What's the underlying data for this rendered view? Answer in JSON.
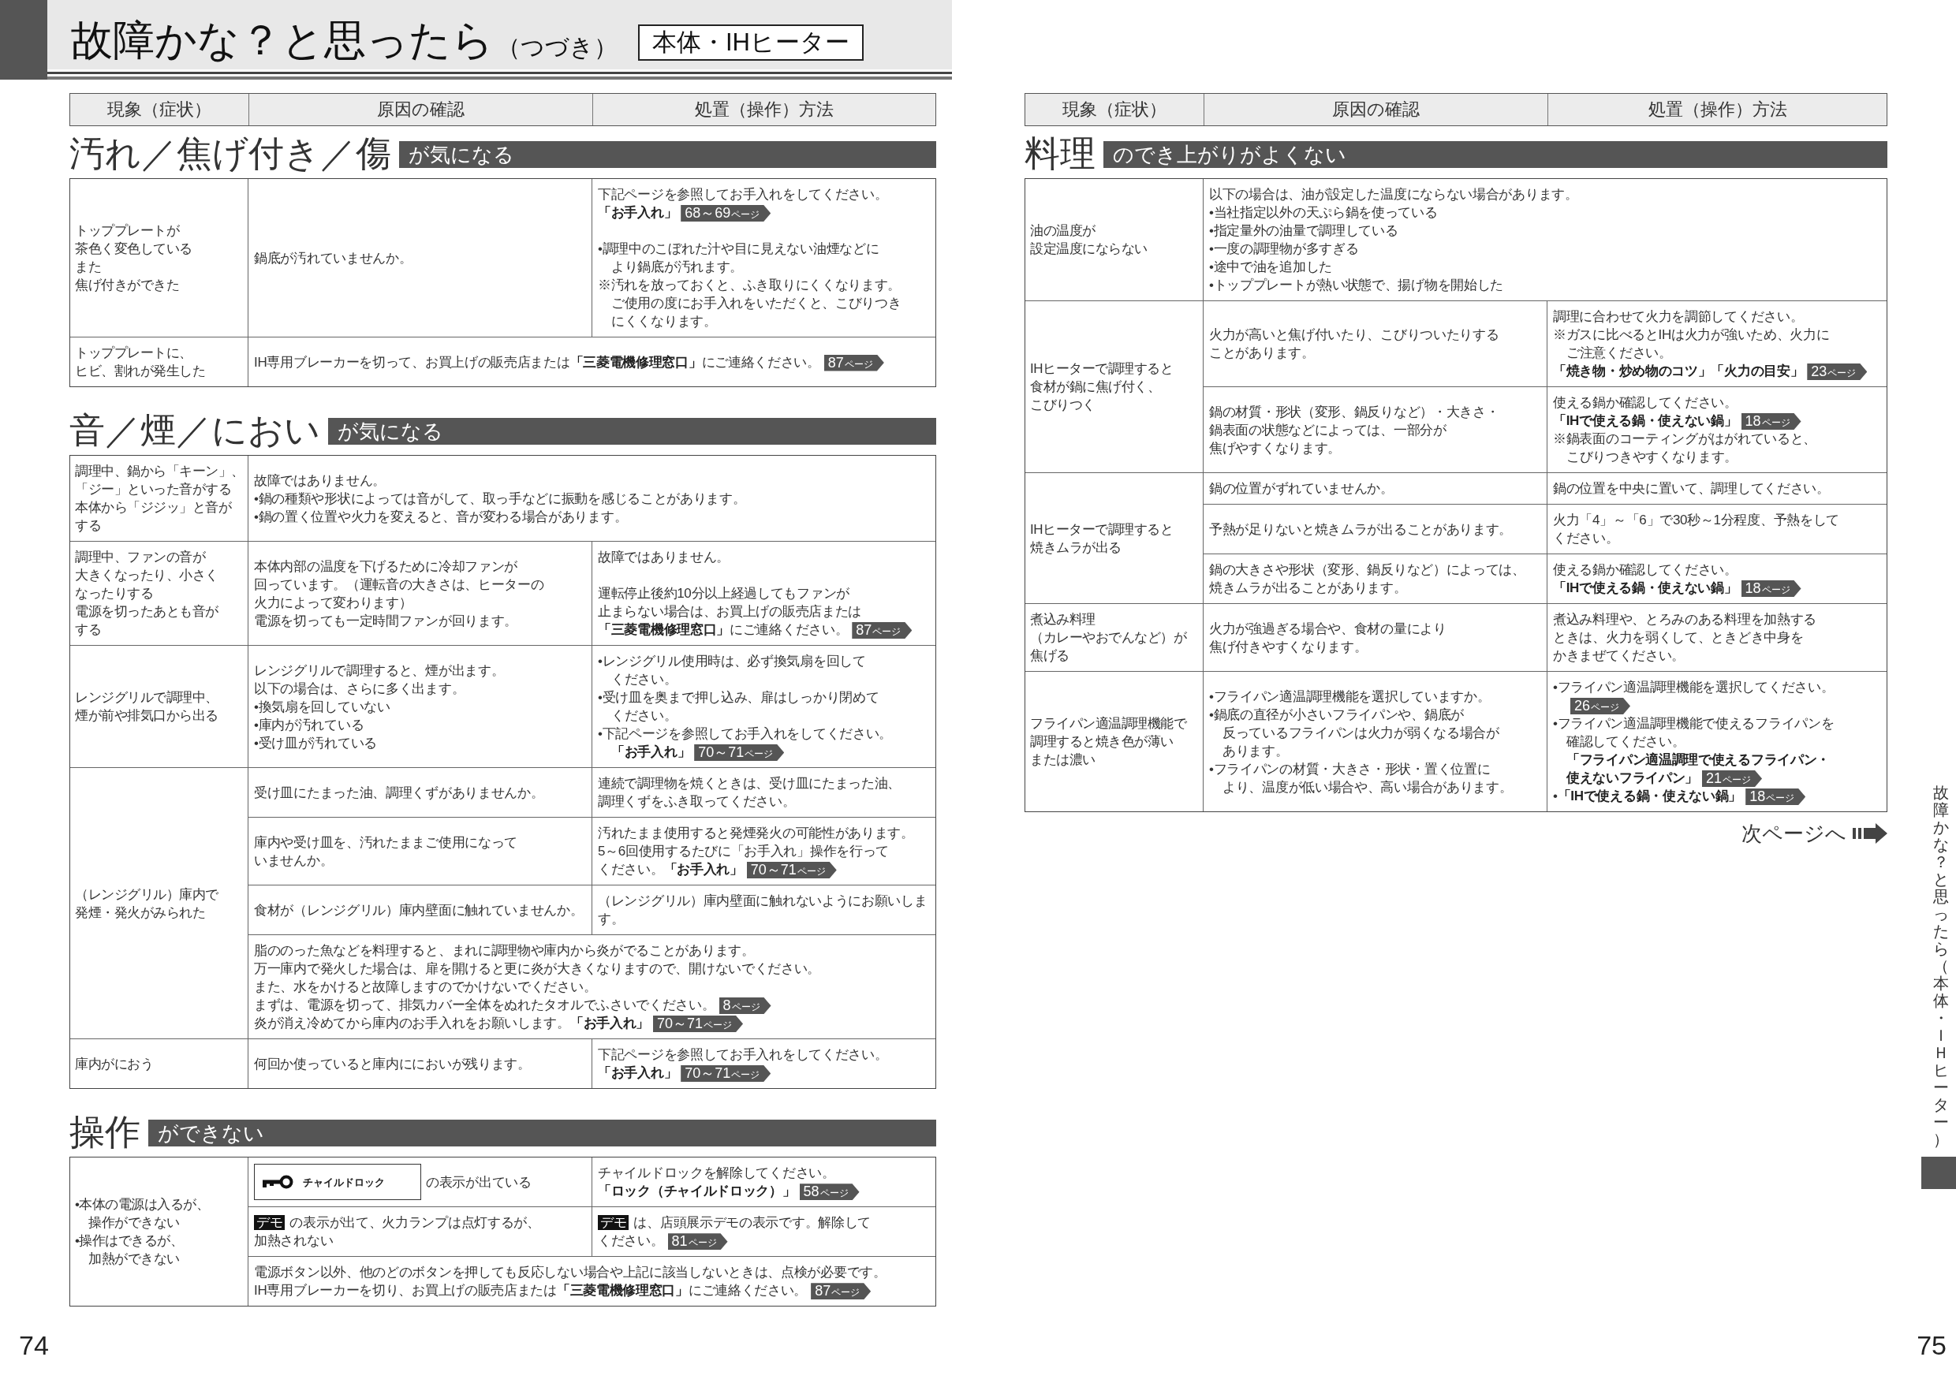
{
  "header": {
    "title": "故障かな？と思ったら",
    "suffix": "（つづき）",
    "category": "本体・IHヒーター"
  },
  "pages": [
    {
      "number": "74",
      "columns": [
        "現象（症状）",
        "原因の確認",
        "処置（操作）方法"
      ],
      "sections": [
        {
          "heading": "汚れ／焦げ付き／傷",
          "banner": "が気になる",
          "rows": [
            {
              "symptom": [
                {
                  "kind": "text",
                  "lines": [
                    "トッププレートが",
                    "茶色く変色している",
                    "また",
                    "焦げ付きができた"
                  ]
                }
              ],
              "entries": [
                {
                  "kind": "split",
                  "cause": [
                    {
                      "kind": "text",
                      "lines": [
                        "鍋底が汚れていませんか。"
                      ]
                    }
                  ],
                  "remedy": [
                    {
                      "kind": "text",
                      "lines": [
                        "下記ページを参照してお手入れをしてください。",
                        "**「お手入れ」**"
                      ],
                      "ref": {
                        "page": "68～69",
                        "unit": "ページ"
                      }
                    },
                    {
                      "kind": "bullet",
                      "spaced": true,
                      "lines": [
                        "•調理中のこぼれた汁や目に見えない油煙などに",
                        "より鍋底が汚れます。"
                      ]
                    },
                    {
                      "kind": "note",
                      "lines": [
                        "※汚れを放っておくと、ふき取りにくくなります。",
                        "ご使用の度にお手入れをいただくと、こびりつき",
                        "にくくなります。"
                      ]
                    }
                  ]
                }
              ]
            },
            {
              "symptom": [
                {
                  "kind": "text",
                  "lines": [
                    "トッププレートに、",
                    "ヒビ、割れが発生した"
                  ]
                }
              ],
              "entries": [
                {
                  "kind": "merged",
                  "content": [
                    {
                      "kind": "text",
                      "lines": [
                        "IH専用ブレーカーを切って、お買上げの販売店または**「三菱電機修理窓口」**にご連絡ください。"
                      ],
                      "ref": {
                        "page": "87",
                        "unit": "ページ"
                      }
                    }
                  ]
                }
              ]
            }
          ]
        },
        {
          "heading": "音／煙／におい",
          "banner": "が気になる",
          "rows": [
            {
              "symptom": [
                {
                  "kind": "text",
                  "lines": [
                    "調理中、鍋から「キーン」、",
                    "「ジー」といった音がする",
                    "本体から「ジジッ」と音が",
                    "する"
                  ]
                }
              ],
              "entries": [
                {
                  "kind": "merged",
                  "content": [
                    {
                      "kind": "text",
                      "lines": [
                        "故障ではありません。"
                      ]
                    },
                    {
                      "kind": "bullet",
                      "lines": [
                        "•鍋の種類や形状によっては音がして、取っ手などに振動を感じることがあります。"
                      ]
                    },
                    {
                      "kind": "bullet",
                      "lines": [
                        "•鍋の置く位置や火力を変えると、音が変わる場合があります。"
                      ]
                    }
                  ]
                }
              ]
            },
            {
              "symptom": [
                {
                  "kind": "text",
                  "lines": [
                    "調理中、ファンの音が",
                    "大きくなったり、小さく",
                    "なったりする",
                    "電源を切ったあとも音が",
                    "する"
                  ]
                }
              ],
              "entries": [
                {
                  "kind": "split",
                  "cause": [
                    {
                      "kind": "text",
                      "lines": [
                        "本体内部の温度を下げるために冷却ファンが",
                        "回っています。（運転音の大きさは、ヒーターの",
                        "火力によって変わります）",
                        "電源を切っても一定時間ファンが回ります。"
                      ]
                    }
                  ],
                  "remedy": [
                    {
                      "kind": "text",
                      "lines": [
                        "故障ではありません。"
                      ]
                    },
                    {
                      "kind": "text",
                      "spaced": true,
                      "lines": [
                        "運転停止後約10分以上経過してもファンが",
                        "止まらない場合は、お買上げの販売店または",
                        "**「三菱電機修理窓口」**にご連絡ください。"
                      ],
                      "ref": {
                        "page": "87",
                        "unit": "ページ"
                      }
                    }
                  ]
                }
              ]
            },
            {
              "symptom": [
                {
                  "kind": "text",
                  "lines": [
                    "レンジグリルで調理中、",
                    "煙が前や排気口から出る"
                  ]
                }
              ],
              "entries": [
                {
                  "kind": "split",
                  "cause": [
                    {
                      "kind": "text",
                      "lines": [
                        "レンジグリルで調理すると、煙が出ます。",
                        "以下の場合は、さらに多く出ます。"
                      ]
                    },
                    {
                      "kind": "bullet",
                      "lines": [
                        "•換気扇を回していない"
                      ]
                    },
                    {
                      "kind": "bullet",
                      "lines": [
                        "•庫内が汚れている"
                      ]
                    },
                    {
                      "kind": "bullet",
                      "lines": [
                        "•受け皿が汚れている"
                      ]
                    }
                  ],
                  "remedy": [
                    {
                      "kind": "bullet",
                      "lines": [
                        "•レンジグリル使用時は、必ず換気扇を回して",
                        "ください。"
                      ]
                    },
                    {
                      "kind": "bullet",
                      "lines": [
                        "•受け皿を奥まで押し込み、扉はしっかり閉めて",
                        "ください。"
                      ]
                    },
                    {
                      "kind": "bullet",
                      "lines": [
                        "•下記ページを参照してお手入れをしてください。",
                        "**「お手入れ」**"
                      ],
                      "ref": {
                        "page": "70～71",
                        "unit": "ページ"
                      }
                    }
                  ]
                }
              ]
            },
            {
              "symptom": [
                {
                  "kind": "text",
                  "lines": [
                    "（レンジグリル）庫内で",
                    "発煙・発火がみられた"
                  ]
                }
              ],
              "entries": [
                {
                  "kind": "split",
                  "cause": [
                    {
                      "kind": "text",
                      "lines": [
                        "受け皿にたまった油、調理くずがありませんか。"
                      ]
                    }
                  ],
                  "remedy": [
                    {
                      "kind": "text",
                      "lines": [
                        "連続で調理物を焼くときは、受け皿にたまった油、",
                        "調理くずをふき取ってください。"
                      ]
                    }
                  ]
                },
                {
                  "kind": "split",
                  "cause": [
                    {
                      "kind": "text",
                      "lines": [
                        "庫内や受け皿を、汚れたままご使用になって",
                        "いませんか。"
                      ]
                    }
                  ],
                  "remedy": [
                    {
                      "kind": "text",
                      "lines": [
                        "汚れたまま使用すると発煙発火の可能性があります。",
                        "5～6回使用するたびに「お手入れ」操作を行って",
                        "ください。**「お手入れ」**"
                      ],
                      "ref": {
                        "page": "70～71",
                        "unit": "ページ"
                      }
                    }
                  ]
                },
                {
                  "kind": "split",
                  "cause": [
                    {
                      "kind": "text",
                      "lines": [
                        "食材が（レンジグリル）庫内壁面に触れていませんか。"
                      ]
                    }
                  ],
                  "remedy": [
                    {
                      "kind": "text",
                      "lines": [
                        "（レンジグリル）庫内壁面に触れないようにお願いします。"
                      ]
                    }
                  ]
                },
                {
                  "kind": "merged",
                  "content": [
                    {
                      "kind": "text",
                      "lines": [
                        "脂ののった魚などを料理すると、まれに調理物や庫内から炎がでることがあります。",
                        "万一庫内で発火した場合は、扉を開けると更に炎が大きくなりますので、開けないでください。",
                        "また、水をかけると故障しますのでかけないでください。",
                        "まずは、電源を切って、排気カバー全体をぬれたタオルでふさいでください。"
                      ],
                      "ref": {
                        "page": "8",
                        "unit": "ページ"
                      }
                    },
                    {
                      "kind": "text",
                      "lines": [
                        "炎が消え冷めてから庫内のお手入れをお願いします。**「お手入れ」**"
                      ],
                      "ref": {
                        "page": "70～71",
                        "unit": "ページ"
                      }
                    }
                  ]
                }
              ]
            },
            {
              "symptom": [
                {
                  "kind": "text",
                  "lines": [
                    "庫内がにおう"
                  ]
                }
              ],
              "entries": [
                {
                  "kind": "split",
                  "cause": [
                    {
                      "kind": "text",
                      "lines": [
                        "何回か使っていると庫内ににおいが残ります。"
                      ]
                    }
                  ],
                  "remedy": [
                    {
                      "kind": "text",
                      "lines": [
                        "下記ページを参照してお手入れをしてください。",
                        "**「お手入れ」**"
                      ],
                      "ref": {
                        "page": "70～71",
                        "unit": "ページ"
                      }
                    }
                  ]
                }
              ]
            }
          ]
        },
        {
          "heading": "操作",
          "banner": "ができない",
          "rows": [
            {
              "symptom": [
                {
                  "kind": "bullet",
                  "lines": [
                    "•本体の電源は入るが、",
                    "操作ができない"
                  ]
                },
                {
                  "kind": "bullet",
                  "lines": [
                    "•操作はできるが、",
                    "加熱ができない"
                  ]
                }
              ],
              "entries": [
                {
                  "kind": "split",
                  "cause": [
                    {
                      "kind": "display",
                      "label": "チャイルドロック",
                      "lines": [
                        "の表示が出ている"
                      ]
                    }
                  ],
                  "remedy": [
                    {
                      "kind": "text",
                      "lines": [
                        "チャイルドロックを解除してください。",
                        "**「ロック（チャイルドロック）」**"
                      ],
                      "ref": {
                        "page": "58",
                        "unit": "ページ"
                      }
                    }
                  ]
                },
                {
                  "kind": "split",
                  "cause": [
                    {
                      "kind": "tag",
                      "tag": "デモ",
                      "lines": [
                        "の表示が出て、火力ランプは点灯するが、",
                        "加熱されない"
                      ]
                    }
                  ],
                  "remedy": [
                    {
                      "kind": "tag",
                      "tag": "デモ",
                      "lines": [
                        "は、店頭展示デモの表示です。解除して",
                        "ください。"
                      ],
                      "ref": {
                        "page": "81",
                        "unit": "ページ"
                      }
                    }
                  ]
                },
                {
                  "kind": "merged",
                  "content": [
                    {
                      "kind": "text",
                      "lines": [
                        "電源ボタン以外、他のどのボタンを押しても反応しない場合や上記に該当しないときは、点検が必要です。",
                        "IH専用ブレーカーを切り、お買上げの販売店または**「三菱電機修理窓口」**にご連絡ください。"
                      ],
                      "ref": {
                        "page": "87",
                        "unit": "ページ"
                      }
                    }
                  ]
                }
              ]
            }
          ]
        }
      ]
    },
    {
      "number": "75",
      "columns": [
        "現象（症状）",
        "原因の確認",
        "処置（操作）方法"
      ],
      "sections": [
        {
          "heading": "料理",
          "banner": "のでき上がりがよくない",
          "rows": [
            {
              "symptom": [
                {
                  "kind": "text",
                  "lines": [
                    "油の温度が",
                    "設定温度にならない"
                  ]
                }
              ],
              "entries": [
                {
                  "kind": "merged",
                  "content": [
                    {
                      "kind": "text",
                      "lines": [
                        "以下の場合は、油が設定した温度にならない場合があります。"
                      ]
                    },
                    {
                      "kind": "bullet",
                      "lines": [
                        "•当社指定以外の天ぷら鍋を使っている"
                      ]
                    },
                    {
                      "kind": "bullet",
                      "lines": [
                        "•指定量外の油量で調理している"
                      ]
                    },
                    {
                      "kind": "bullet",
                      "lines": [
                        "•一度の調理物が多すぎる"
                      ]
                    },
                    {
                      "kind": "bullet",
                      "lines": [
                        "•途中で油を追加した"
                      ]
                    },
                    {
                      "kind": "bullet",
                      "lines": [
                        "•トッププレートが熱い状態で、揚げ物を開始した"
                      ]
                    }
                  ]
                }
              ]
            },
            {
              "symptom": [
                {
                  "kind": "text",
                  "lines": [
                    "IHヒーターで調理すると",
                    "食材が鍋に焦げ付く、",
                    "こびりつく"
                  ]
                }
              ],
              "entries": [
                {
                  "kind": "split",
                  "cause": [
                    {
                      "kind": "text",
                      "lines": [
                        "火力が高いと焦げ付いたり、こびりついたりする",
                        "ことがあります。"
                      ]
                    }
                  ],
                  "remedy": [
                    {
                      "kind": "text",
                      "lines": [
                        "調理に合わせて火力を調節してください。"
                      ]
                    },
                    {
                      "kind": "note",
                      "lines": [
                        "※ガスに比べるとIHは火力が強いため、火力に",
                        "ご注意ください。"
                      ]
                    },
                    {
                      "kind": "text",
                      "bold": true,
                      "lines": [
                        "「焼き物・炒め物のコツ」「火力の目安」"
                      ],
                      "ref": {
                        "page": "23",
                        "unit": "ページ"
                      }
                    }
                  ]
                },
                {
                  "kind": "split",
                  "cause": [
                    {
                      "kind": "text",
                      "lines": [
                        "鍋の材質・形状（変形、鍋反りなど）・大きさ・",
                        "鍋表面の状態などによっては、一部分が",
                        "焦げやすくなります。"
                      ]
                    }
                  ],
                  "remedy": [
                    {
                      "kind": "text",
                      "lines": [
                        "使える鍋か確認してください。",
                        "**「IHで使える鍋・使えない鍋」**"
                      ],
                      "ref": {
                        "page": "18",
                        "unit": "ページ"
                      }
                    },
                    {
                      "kind": "note",
                      "lines": [
                        "※鍋表面のコーティングがはがれていると、",
                        "こびりつきやすくなります。"
                      ]
                    }
                  ]
                }
              ]
            },
            {
              "symptom": [
                {
                  "kind": "text",
                  "lines": [
                    "IHヒーターで調理すると",
                    "焼きムラが出る"
                  ]
                }
              ],
              "entries": [
                {
                  "kind": "split",
                  "cause": [
                    {
                      "kind": "text",
                      "lines": [
                        "鍋の位置がずれていませんか。"
                      ]
                    }
                  ],
                  "remedy": [
                    {
                      "kind": "text",
                      "lines": [
                        "鍋の位置を中央に置いて、調理してください。"
                      ]
                    }
                  ]
                },
                {
                  "kind": "split",
                  "cause": [
                    {
                      "kind": "text",
                      "lines": [
                        "予熱が足りないと焼きムラが出ることがあります。"
                      ]
                    }
                  ],
                  "remedy": [
                    {
                      "kind": "text",
                      "lines": [
                        "火力「4」～「6」で30秒～1分程度、予熱をして",
                        "ください。"
                      ]
                    }
                  ]
                },
                {
                  "kind": "split",
                  "cause": [
                    {
                      "kind": "text",
                      "lines": [
                        "鍋の大きさや形状（変形、鍋反りなど）によっては、",
                        "焼きムラが出ることがあります。"
                      ]
                    }
                  ],
                  "remedy": [
                    {
                      "kind": "text",
                      "lines": [
                        "使える鍋か確認してください。",
                        "**「IHで使える鍋・使えない鍋」**"
                      ],
                      "ref": {
                        "page": "18",
                        "unit": "ページ"
                      }
                    }
                  ]
                }
              ]
            },
            {
              "symptom": [
                {
                  "kind": "text",
                  "lines": [
                    "煮込み料理",
                    "（カレーやおでんなど）が",
                    "焦げる"
                  ]
                }
              ],
              "entries": [
                {
                  "kind": "split",
                  "cause": [
                    {
                      "kind": "text",
                      "lines": [
                        "火力が強過ぎる場合や、食材の量により",
                        "焦げ付きやすくなります。"
                      ]
                    }
                  ],
                  "remedy": [
                    {
                      "kind": "text",
                      "lines": [
                        "煮込み料理や、とろみのある料理を加熱する",
                        "ときは、火力を弱くして、ときどき中身を",
                        "かきまぜてください。"
                      ]
                    }
                  ]
                }
              ]
            },
            {
              "symptom": [
                {
                  "kind": "text",
                  "lines": [
                    "フライパン適温調理機能で",
                    "調理すると焼き色が薄い",
                    "または濃い"
                  ]
                }
              ],
              "entries": [
                {
                  "kind": "split",
                  "cause": [
                    {
                      "kind": "bullet",
                      "lines": [
                        "•フライパン適温調理機能を選択していますか。"
                      ]
                    },
                    {
                      "kind": "bullet",
                      "lines": [
                        "•鍋底の直径が小さいフライパンや、鍋底が",
                        "反っているフライパンは火力が弱くなる場合が",
                        "あります。"
                      ]
                    },
                    {
                      "kind": "bullet",
                      "lines": [
                        "•フライパンの材質・大きさ・形状・置く位置に",
                        "より、温度が低い場合や、高い場合があります。"
                      ]
                    }
                  ],
                  "remedy": [
                    {
                      "kind": "bullet",
                      "lines": [
                        "•フライパン適温調理機能を選択してください。"
                      ],
                      "ref": {
                        "page": "26",
                        "unit": "ページ"
                      }
                    },
                    {
                      "kind": "bullet",
                      "lines": [
                        "•フライパン適温調理機能で使えるフライパンを",
                        "確認してください。",
                        "**「フライパン適温調理で使えるフライパン・**",
                        "**使えないフライパン」**"
                      ],
                      "ref": {
                        "page": "21",
                        "unit": "ページ"
                      }
                    },
                    {
                      "kind": "bullet",
                      "lines": [
                        "•**「IHで使える鍋・使えない鍋」**"
                      ],
                      "ref": {
                        "page": "18",
                        "unit": "ページ"
                      }
                    }
                  ]
                }
              ]
            }
          ]
        }
      ],
      "next_page": "次ページへ"
    }
  ],
  "side_tab": "故障かな？と思ったら（本体・ＩＨヒーター）"
}
